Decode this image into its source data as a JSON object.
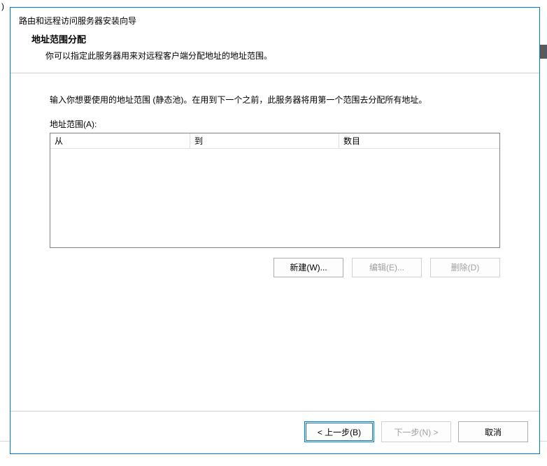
{
  "outer_fragment": ")",
  "dialog": {
    "title": "路由和远程访问服务器安装向导",
    "heading": "地址范围分配",
    "subheading": "你可以指定此服务器用来对远程客户端分配地址的地址范围。",
    "instruction": "输入你想要使用的地址范围 (静态池)。在用到下一个之前，此服务器将用第一个范围去分配所有地址。",
    "list_label": "地址范围(A):",
    "columns": {
      "from": "从",
      "to": "到",
      "count": "数目"
    },
    "buttons": {
      "new": "新建(W)...",
      "edit": "编辑(E)...",
      "delete": "删除(D)"
    },
    "footer": {
      "back": "< 上一步(B)",
      "next": "下一步(N) >",
      "cancel": "取消"
    }
  }
}
